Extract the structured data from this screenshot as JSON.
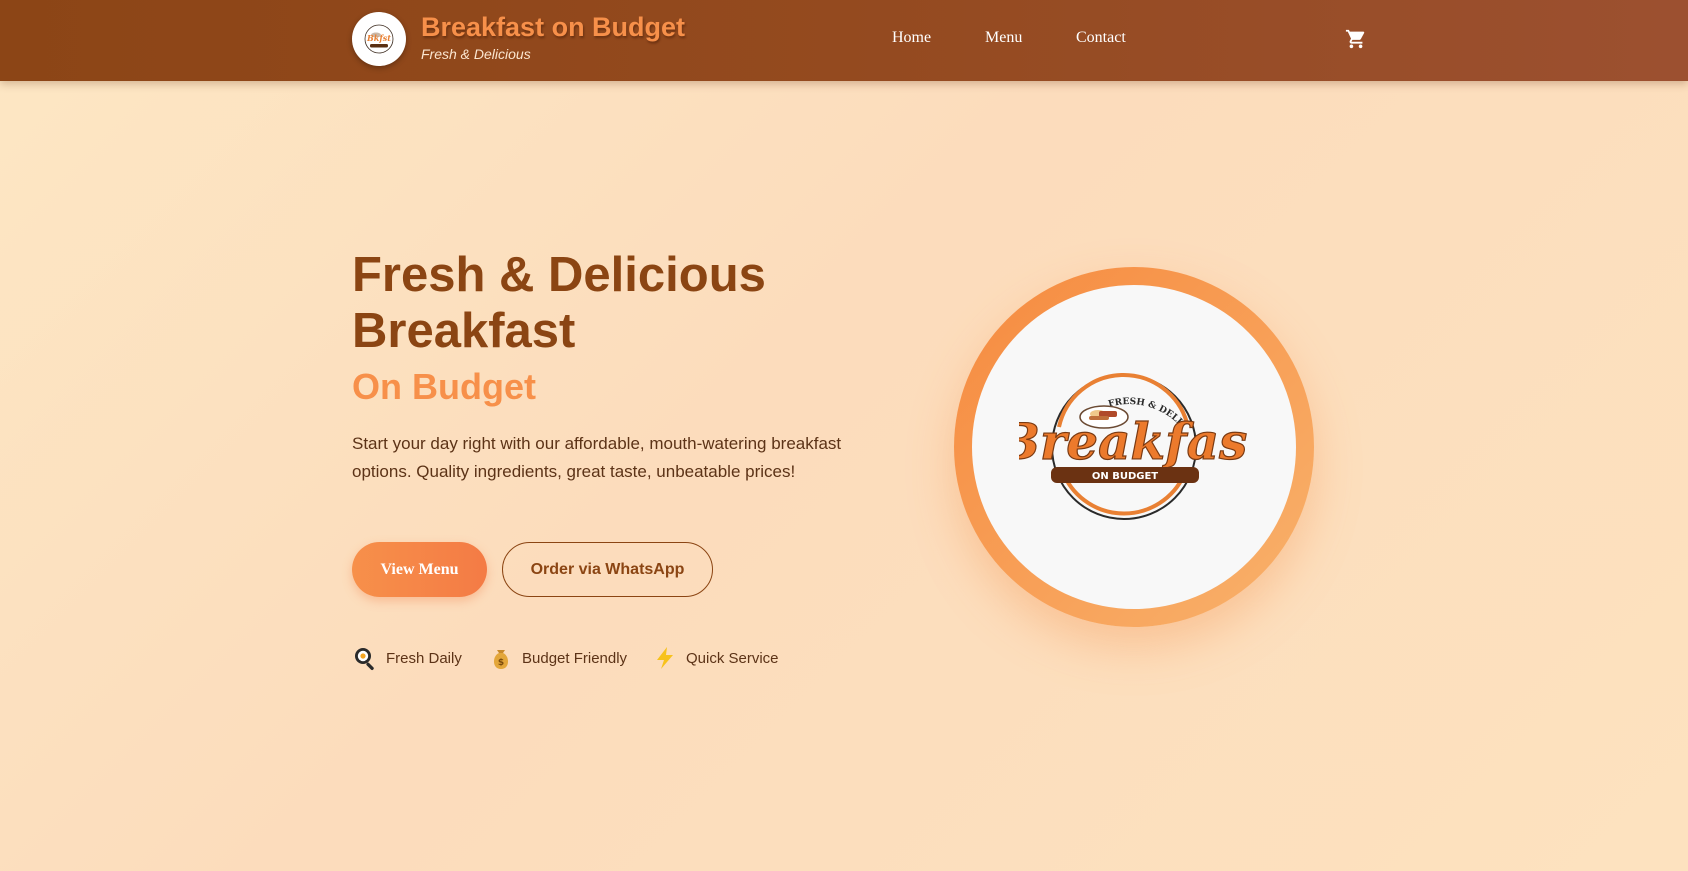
{
  "header": {
    "brand_title": "Breakfast on Budget",
    "brand_tagline": "Fresh & Delicious",
    "nav": [
      {
        "label": "Home"
      },
      {
        "label": "Menu"
      },
      {
        "label": "Contact"
      }
    ],
    "cart_icon": "shopping-cart-icon"
  },
  "hero": {
    "title": "Fresh & Delicious Breakfast",
    "subtitle": "On Budget",
    "description": "Start your day right with our affordable, mouth-watering breakfast options. Quality ingredients, great taste, unbeatable prices!",
    "primary_button": "View Menu",
    "secondary_button": "Order via WhatsApp",
    "features": [
      {
        "icon": "frying-pan-icon",
        "label": "Fresh Daily"
      },
      {
        "icon": "money-bag-icon",
        "label": "Budget Friendly"
      },
      {
        "icon": "lightning-icon",
        "label": "Quick Service"
      }
    ]
  },
  "logo": {
    "arc_text": "FRESH & DELICIOUS",
    "wordmark": "Breakfast",
    "banner": "ON BUDGET"
  },
  "colors": {
    "header_brown": "#8c4516",
    "accent_orange": "#f7904a",
    "title_brown": "#8b4513",
    "text_brown": "#5c3317",
    "background": "#fde2bf"
  }
}
